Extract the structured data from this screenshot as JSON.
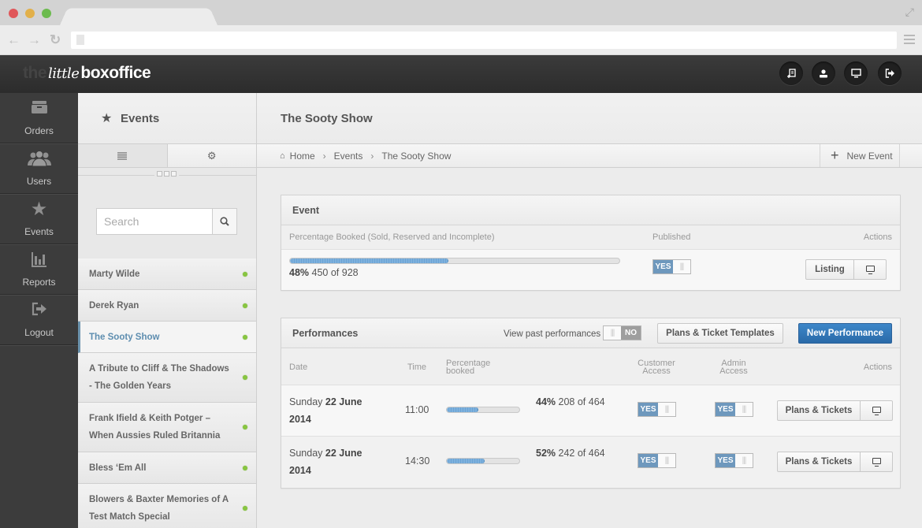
{
  "browser": {
    "back_icon": "arrow-left",
    "forward_icon": "arrow-right",
    "reload_icon": "reload",
    "url": ""
  },
  "header": {
    "logo_parts": [
      "the",
      "little",
      "boxoffice"
    ],
    "buttons": [
      {
        "name": "new-note",
        "icon": "note-plus-icon"
      },
      {
        "name": "user",
        "icon": "user-icon"
      },
      {
        "name": "display",
        "icon": "monitor-icon"
      },
      {
        "name": "signout",
        "icon": "sign-out-icon"
      }
    ]
  },
  "nav": {
    "items": [
      {
        "label": "Orders",
        "icon": "archive-icon"
      },
      {
        "label": "Users",
        "icon": "users-icon"
      },
      {
        "label": "Events",
        "icon": "star-icon"
      },
      {
        "label": "Reports",
        "icon": "bar-chart-icon"
      },
      {
        "label": "Logout",
        "icon": "sign-out-icon"
      }
    ]
  },
  "events_panel": {
    "title": "Events",
    "search_placeholder": "Search",
    "search_value": "",
    "items": [
      {
        "label": "Marty Wilde",
        "status": "active"
      },
      {
        "label": "Derek Ryan",
        "status": "active"
      },
      {
        "label": "The Sooty Show",
        "status": "active",
        "selected": true
      },
      {
        "label": "A Tribute to Cliff & The Shadows - The Golden Years",
        "status": "active"
      },
      {
        "label": "Frank Ifield & Keith Potger – When Aussies Ruled Britannia",
        "status": "active"
      },
      {
        "label": "Bless ‘Em All",
        "status": "active"
      },
      {
        "label": "Blowers & Baxter Memories of A Test Match Special",
        "status": "active"
      }
    ]
  },
  "main": {
    "title": "The Sooty Show",
    "breadcrumb": [
      "Home",
      "Events",
      "The Sooty Show"
    ],
    "new_event_label": "New Event",
    "event": {
      "title": "Event",
      "col_pct": "Percentage Booked (Sold, Reserved and Incomplete)",
      "col_published": "Published",
      "col_actions": "Actions",
      "pct_label": "48%",
      "booked": "450 of 928",
      "progress": 0.48,
      "published": "YES",
      "listing_label": "Listing"
    },
    "performances": {
      "title": "Performances",
      "view_past_label": "View past performances",
      "view_past_value": "NO",
      "templates_label": "Plans & Ticket Templates",
      "new_label": "New Performance",
      "columns": {
        "date": "Date",
        "time": "Time",
        "pct": "Percentage booked",
        "customer": "Customer Access",
        "admin": "Admin Access",
        "actions": "Actions"
      },
      "rows": [
        {
          "day": "Sunday",
          "date": "22 June 2014",
          "time": "11:00",
          "pct_label": "44%",
          "booked": "208 of 464",
          "progress": 0.44,
          "customer": "YES",
          "admin": "YES",
          "action_label": "Plans & Tickets"
        },
        {
          "day": "Sunday",
          "date": "22 June 2014",
          "time": "14:30",
          "pct_label": "52%",
          "booked": "242 of 464",
          "progress": 0.52,
          "customer": "YES",
          "admin": "YES",
          "action_label": "Plans & Tickets"
        }
      ]
    }
  },
  "colors": {
    "accent_blue": "#2f74b5",
    "toggle_on": "#6e98bd",
    "status_green": "#88c541",
    "selected_text": "#5d8daf"
  }
}
